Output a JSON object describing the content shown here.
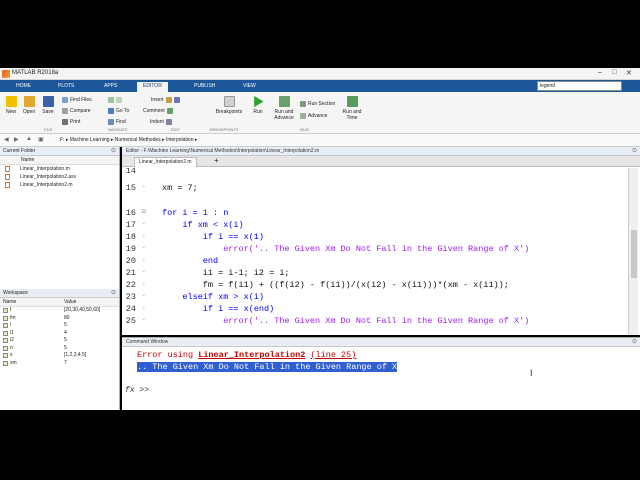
{
  "window": {
    "title": "MATLAB R2018a",
    "min": "–",
    "max": "□",
    "close": "✕"
  },
  "tabs": [
    "HOME",
    "PLOTS",
    "APPS",
    "EDITOR",
    "PUBLISH",
    "VIEW"
  ],
  "active_tab": "EDITOR",
  "search": {
    "value": "legend"
  },
  "toolstrip": {
    "file_buttons": [
      "New",
      "Open",
      "Save"
    ],
    "find_files": "Find Files",
    "compare": "Compare",
    "print": "Print",
    "goto": "Go To",
    "find": "Find",
    "insert": "Insert",
    "comment": "Comment",
    "indent": "Indent",
    "breakpoints": "Breakpoints",
    "run": "Run",
    "run_and_advance": [
      "Run and",
      "Advance"
    ],
    "run_section": "Run Section",
    "advance": "Advance",
    "run_and_time": [
      "Run and",
      "Time"
    ],
    "sections": [
      "FILE",
      "NAVIGATE",
      "EDIT",
      "BREAKPOINTS",
      "RUN"
    ]
  },
  "address": {
    "crumbs": [
      "F:",
      "Machine Learning",
      "Numerical Methodes",
      "Interpolation"
    ]
  },
  "current_folder": {
    "title": "Current Folder",
    "col_name": "Name",
    "files": [
      "Linear_Interpolation.m",
      "Linear_Interpolation2.asv",
      "Linear_Interpolation2.m"
    ]
  },
  "workspace": {
    "title": "Workspace",
    "col_name": "Name",
    "col_value": "Value",
    "vars": [
      {
        "name": "f",
        "value": "[20,30,40,50,60]"
      },
      {
        "name": "fm",
        "value": "80"
      },
      {
        "name": "i",
        "value": "5"
      },
      {
        "name": "i1",
        "value": "4"
      },
      {
        "name": "i2",
        "value": "5"
      },
      {
        "name": "n",
        "value": "5"
      },
      {
        "name": "x",
        "value": "[1,2,3,4,5]"
      },
      {
        "name": "xm",
        "value": "7"
      }
    ]
  },
  "editor": {
    "header": "Editor - F:\\Machine Learning\\Numerical Methodes\\Interpolation\\Linear_Interpolation2.m",
    "file_tab": "Linear_Interpolation2.m",
    "lines": [
      {
        "n": "14",
        "code": ""
      },
      {
        "n": "15",
        "code": "xm = 7;"
      },
      {
        "n": "16",
        "code": "for i = 1 : n"
      },
      {
        "n": "17",
        "code": "    if xm < x(i)"
      },
      {
        "n": "18",
        "code": "        if i == x(1)"
      },
      {
        "n": "19",
        "code": "            error('.. The Given Xm Do Not Fall in the Given Range of X')"
      },
      {
        "n": "20",
        "code": "        end"
      },
      {
        "n": "21",
        "code": "        i1 = i-1; i2 = i;"
      },
      {
        "n": "22",
        "code": "        fm = f(i1) + ((f(i2) - f(i1))/(x(i2) - x(i1)))*(xm - x(i1));"
      },
      {
        "n": "23",
        "code": "    elseif xm > x(i)"
      },
      {
        "n": "24",
        "code": "        if i == x(end)"
      },
      {
        "n": "25",
        "code": "            error('.. The Given Xm Do Not Fall in the Given Range of X')"
      }
    ]
  },
  "command_window": {
    "title": "Command Window",
    "error_prefix": "Error using ",
    "error_func": "Linear_Interpolation2",
    "error_line": "(line 25)",
    "message": ".. The Given Xm Do Not Fall in the Given Range of X",
    "fx": "fx",
    "prompt": ">>"
  }
}
